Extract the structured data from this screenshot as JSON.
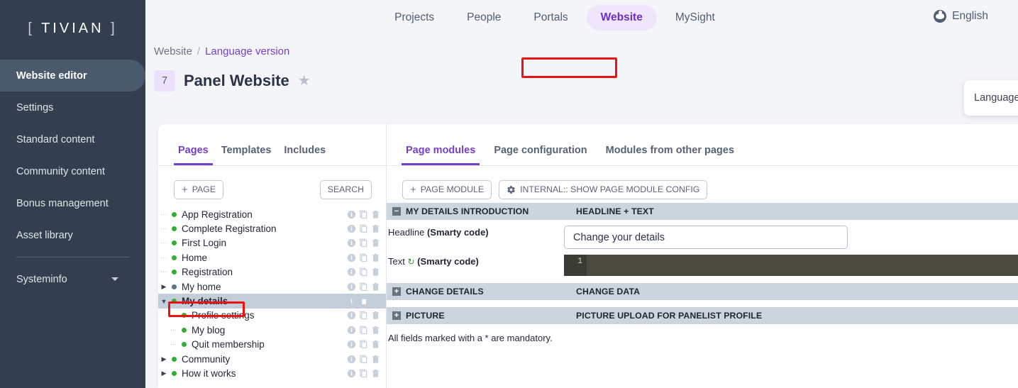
{
  "sidebar": {
    "logo": "TIVIAN",
    "bracket_left": "[",
    "bracket_right": "]",
    "items": [
      {
        "label": "Website editor",
        "active": true
      },
      {
        "label": "Settings",
        "active": false
      },
      {
        "label": "Standard content",
        "active": false
      },
      {
        "label": "Community content",
        "active": false
      },
      {
        "label": "Bonus management",
        "active": false
      },
      {
        "label": "Asset library",
        "active": false
      }
    ],
    "systeminfo": {
      "label": "Systeminfo",
      "icon": "chevron-down-icon"
    }
  },
  "topnav": {
    "items": [
      {
        "label": "Projects",
        "active": false
      },
      {
        "label": "People",
        "active": false
      },
      {
        "label": "Portals",
        "active": false
      },
      {
        "label": "Website",
        "active": true
      },
      {
        "label": "MySight",
        "active": false
      }
    ],
    "language": {
      "label": "English",
      "icon": "globe-icon"
    }
  },
  "breadcrumb": {
    "root": "Website",
    "separator": "/",
    "current": "Language version"
  },
  "page_header": {
    "badge": "7",
    "title": "Panel Website",
    "favorite_icon": "star-icon"
  },
  "floating_card": {
    "label": "Language version"
  },
  "left_panel": {
    "tabs": [
      {
        "label": "Pages",
        "active": true
      },
      {
        "label": "Templates",
        "active": false
      },
      {
        "label": "Includes",
        "active": false
      }
    ],
    "add_page_button": "PAGE",
    "add_page_plus": "+",
    "search_button": "SEARCH",
    "tree": [
      {
        "label": "App Registration",
        "level": 0,
        "knob": "",
        "dot": "green",
        "selected": false,
        "leader": true
      },
      {
        "label": "Complete Registration",
        "level": 0,
        "knob": "",
        "dot": "green",
        "selected": false,
        "leader": true
      },
      {
        "label": "First Login",
        "level": 0,
        "knob": "",
        "dot": "green",
        "selected": false,
        "leader": true
      },
      {
        "label": "Home",
        "level": 0,
        "knob": "",
        "dot": "green",
        "selected": false,
        "leader": true
      },
      {
        "label": "Registration",
        "level": 0,
        "knob": "",
        "dot": "green",
        "selected": false,
        "leader": true
      },
      {
        "label": "My home",
        "level": 0,
        "knob": "collapsed",
        "dot": "gray",
        "selected": false,
        "leader": false
      },
      {
        "label": "My details",
        "level": 0,
        "knob": "expanded",
        "dot": "green",
        "selected": true,
        "leader": false
      },
      {
        "label": "Profile settings",
        "level": 1,
        "knob": "",
        "dot": "green",
        "selected": false,
        "leader": true
      },
      {
        "label": "My blog",
        "level": 1,
        "knob": "",
        "dot": "green",
        "selected": false,
        "leader": true
      },
      {
        "label": "Quit membership",
        "level": 1,
        "knob": "",
        "dot": "green",
        "selected": false,
        "leader": true
      },
      {
        "label": "Community",
        "level": 0,
        "knob": "collapsed",
        "dot": "green",
        "selected": false,
        "leader": false
      },
      {
        "label": "How it works",
        "level": 0,
        "knob": "collapsed",
        "dot": "green",
        "selected": false,
        "leader": false
      }
    ],
    "row_icons": [
      "info-icon",
      "copy-icon",
      "trash-icon"
    ]
  },
  "right_panel": {
    "tabs": [
      {
        "label": "Page modules",
        "active": true
      },
      {
        "label": "Page configuration",
        "active": false
      },
      {
        "label": "Modules from other pages",
        "active": false
      }
    ],
    "add_module_button": "PAGE MODULE",
    "add_module_plus": "+",
    "internal_config_button": "INTERNAL:: SHOW PAGE MODULE CONFIG",
    "internal_config_icon": "gear-icon",
    "modules": [
      {
        "name": "MY DETAILS INTRODUCTION",
        "type": "HEADLINE + TEXT",
        "expanded": true,
        "toggle": "−",
        "fields": [
          {
            "kind": "text",
            "label_main": "Headline ",
            "label_bold": "(Smarty code)",
            "value": "Change your details"
          },
          {
            "kind": "code",
            "label_main": "Text ",
            "label_icon": "recycle-icon",
            "label_bold": "(Smarty code)",
            "line_number": "1"
          }
        ]
      },
      {
        "name": "CHANGE DETAILS",
        "type": "CHANGE DATA",
        "expanded": false,
        "toggle": "+",
        "fields": []
      },
      {
        "name": "PICTURE",
        "type": "PICTURE UPLOAD FOR PANELIST PROFILE",
        "expanded": false,
        "toggle": "+",
        "fields": []
      }
    ],
    "mandatory_note": "All fields marked with a * are mandatory."
  },
  "colors": {
    "sidebar_bg": "#333f4e",
    "sidebar_active": "#4b5a6b",
    "accent_purple": "#7540c9",
    "accent_purple_light": "#efe6fb",
    "module_header_bg": "#ccd5dd",
    "tree_selected_bg": "#c3ceda",
    "status_green": "#35ac35",
    "status_gray": "#5d7084",
    "highlight_red": "#ee1111",
    "code_bg": "#4a4a40",
    "code_gutter": "#3b3b35"
  }
}
